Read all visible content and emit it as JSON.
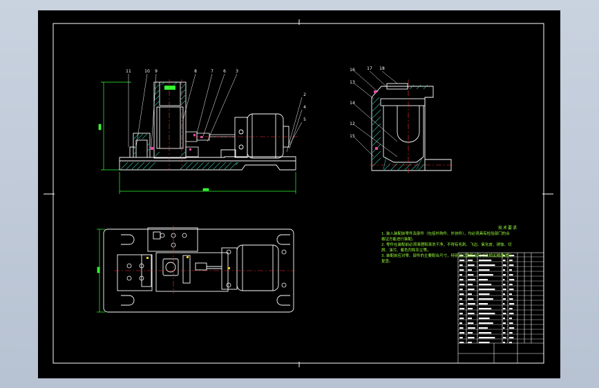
{
  "drawing": {
    "colors": {
      "background": "#000000",
      "frame": "#ffffff",
      "outline": "#ffffff",
      "hatch": "#2ec4a8",
      "dimension": "#33ff33",
      "centerline": "#ff3333",
      "leader": "#ffffff",
      "notes": "#9aff3a",
      "window": "#c3ccda"
    },
    "views": [
      "front-section-view",
      "side-section-view",
      "top-view"
    ],
    "part_balloons_front": [
      "11",
      "10",
      "9",
      "8",
      "7",
      "6",
      "3",
      "2",
      "4",
      "5"
    ],
    "part_balloons_side": [
      "16",
      "17",
      "18",
      "13",
      "14",
      "12",
      "15"
    ]
  },
  "tech_requirements": {
    "title": "技术要求",
    "lines": [
      "1. 装入装配前零件及部件（包括外购件、外协件），均必须具有检验部门的合",
      "格证方能进行装配。",
      "2. 零件在装配前必须清理和清洗干净，不得有毛刺、飞边、氧化皮、锈蚀、切",
      "屑、油污、着色剂和灰尘等。",
      "3. 装配前应对零、部件的主要配合尺寸，特别是过盈配合尺寸及相关精度进行",
      "复查。"
    ]
  }
}
